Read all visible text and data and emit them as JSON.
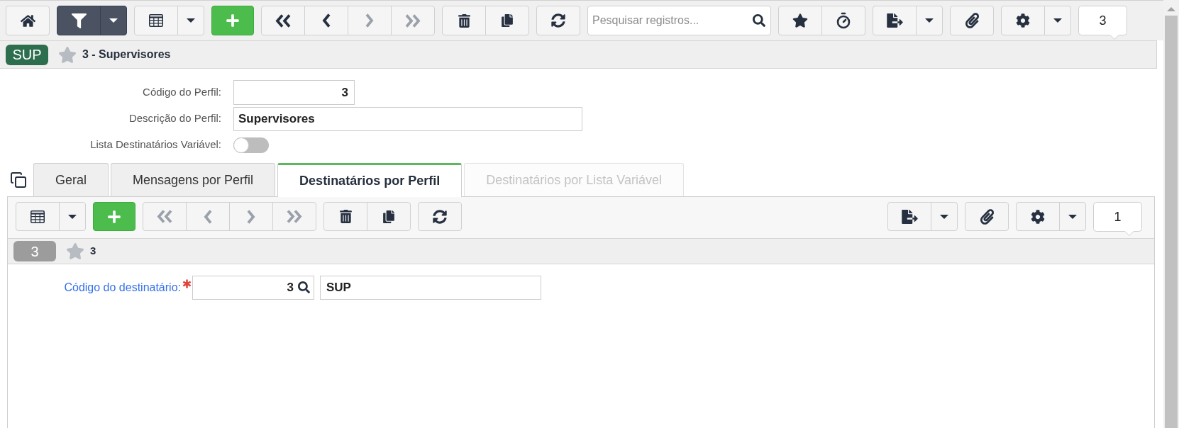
{
  "toolbar": {
    "left_groups": [
      {
        "items": [
          {
            "kind": "home"
          }
        ]
      },
      {
        "on": true,
        "items": [
          {
            "kind": "filter"
          },
          {
            "kind": "dropdown"
          }
        ]
      },
      {
        "items": [
          {
            "kind": "grid"
          },
          {
            "kind": "dropdown"
          }
        ]
      },
      {
        "items": [
          {
            "kind": "add"
          }
        ]
      },
      {
        "items": [
          {
            "kind": "first",
            "disabled": false
          },
          {
            "kind": "previous",
            "disabled": false
          },
          {
            "kind": "next",
            "disabled": true
          },
          {
            "kind": "last",
            "disabled": true
          }
        ]
      },
      {
        "items": [
          {
            "kind": "delete"
          },
          {
            "kind": "copy"
          }
        ]
      },
      {
        "items": [
          {
            "kind": "refresh"
          }
        ]
      }
    ],
    "search": {
      "placeholder": "Pesquisar registros..."
    },
    "right_groups": [
      {
        "items": [
          {
            "kind": "favorite"
          },
          {
            "kind": "timer"
          }
        ]
      },
      {
        "items": [
          {
            "kind": "export"
          },
          {
            "kind": "dropdown"
          }
        ]
      },
      {
        "items": [
          {
            "kind": "attach"
          }
        ]
      },
      {
        "items": [
          {
            "kind": "settings"
          },
          {
            "kind": "dropdown"
          }
        ]
      }
    ],
    "counter": "3"
  },
  "record_header": {
    "badge": "SUP",
    "favorite": false,
    "title": "3 - Supervisores"
  },
  "form": {
    "fields": [
      {
        "kind": "number",
        "label": "Código do Perfil:",
        "value": "3"
      },
      {
        "kind": "text",
        "label": "Descrição do Perfil:",
        "value": "Supervisores"
      },
      {
        "kind": "toggle",
        "label": "Lista Destinatários Variável:",
        "on": false
      }
    ]
  },
  "tabs": [
    {
      "label": "Geral",
      "selected": false,
      "disabled": false
    },
    {
      "label": "Mensagens por Perfil",
      "selected": false,
      "disabled": false
    },
    {
      "label": "Destinatários por Perfil",
      "selected": true,
      "disabled": false
    },
    {
      "label": "Destinatários por Lista Variável",
      "selected": false,
      "disabled": true
    }
  ],
  "tab_panel": {
    "toolbar": {
      "left_groups": [
        {
          "items": [
            {
              "kind": "grid"
            },
            {
              "kind": "dropdown"
            }
          ]
        },
        {
          "items": [
            {
              "kind": "add"
            }
          ]
        },
        {
          "items": [
            {
              "kind": "first",
              "disabled": true
            },
            {
              "kind": "previous",
              "disabled": true
            },
            {
              "kind": "next",
              "disabled": true
            },
            {
              "kind": "last",
              "disabled": true
            }
          ]
        },
        {
          "items": [
            {
              "kind": "delete"
            },
            {
              "kind": "copy"
            }
          ]
        },
        {
          "items": [
            {
              "kind": "refresh"
            }
          ]
        }
      ],
      "right_groups": [
        {
          "items": [
            {
              "kind": "export"
            },
            {
              "kind": "dropdown"
            }
          ]
        },
        {
          "items": [
            {
              "kind": "attach"
            }
          ]
        },
        {
          "items": [
            {
              "kind": "settings"
            },
            {
              "kind": "dropdown"
            }
          ]
        }
      ],
      "counter": "1"
    },
    "record_header": {
      "badge": "3",
      "favorite": false,
      "title": "3"
    },
    "fields": [
      {
        "label": "Código do destinatário:",
        "required": true,
        "code": "3",
        "description": "SUP"
      }
    ]
  }
}
